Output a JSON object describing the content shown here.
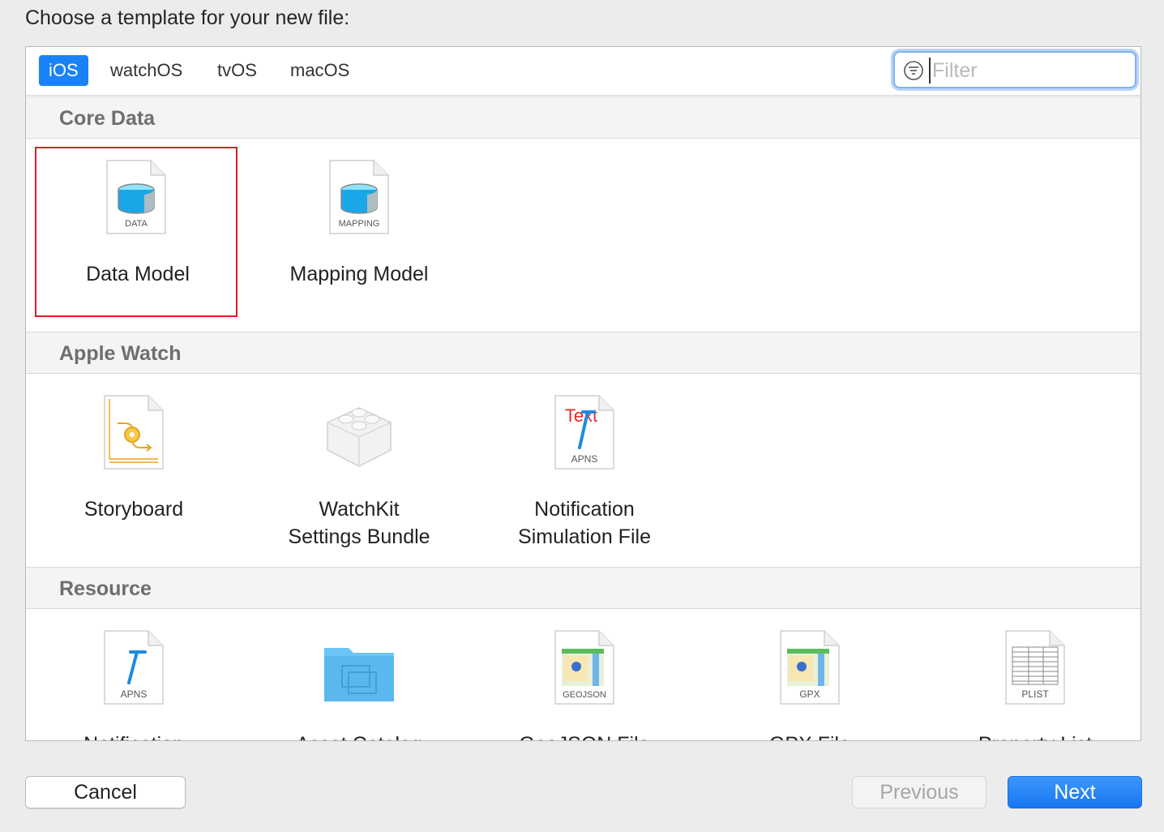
{
  "header": {
    "prompt": "Choose a template for your new file:"
  },
  "tabs": [
    {
      "label": "iOS",
      "active": true
    },
    {
      "label": "watchOS",
      "active": false
    },
    {
      "label": "tvOS",
      "active": false
    },
    {
      "label": "macOS",
      "active": false
    }
  ],
  "filter": {
    "placeholder": "Filter",
    "value": ""
  },
  "sections": [
    {
      "title": "Core Data",
      "items": [
        {
          "label": "Data Model",
          "icon": "data-model-icon",
          "icon_caption": "DATA",
          "selected": true
        },
        {
          "label": "Mapping Model",
          "icon": "mapping-model-icon",
          "icon_caption": "MAPPING",
          "selected": false
        }
      ]
    },
    {
      "title": "Apple Watch",
      "items": [
        {
          "label": "Storyboard",
          "icon": "storyboard-icon"
        },
        {
          "label": "WatchKit\nSettings Bundle",
          "line1": "WatchKit",
          "line2": "Settings Bundle",
          "icon": "settings-bundle-icon"
        },
        {
          "label": "Notification\nSimulation File",
          "line1": "Notification",
          "line2": "Simulation File",
          "icon": "apns-text-icon",
          "icon_caption": "APNS",
          "icon_text": "Text"
        }
      ]
    },
    {
      "title": "Resource",
      "items": [
        {
          "label": "Notification",
          "icon": "apns-icon",
          "icon_caption": "APNS"
        },
        {
          "label": "Asset Catalog",
          "icon": "asset-catalog-folder-icon"
        },
        {
          "label": "GeoJSON File",
          "icon": "geojson-map-icon",
          "icon_caption": "GEOJSON"
        },
        {
          "label": "GPX File",
          "icon": "gpx-map-icon",
          "icon_caption": "GPX"
        },
        {
          "label": "Property List",
          "icon": "plist-icon",
          "icon_caption": "PLIST"
        }
      ]
    }
  ],
  "buttons": {
    "cancel": "Cancel",
    "previous": "Previous",
    "next": "Next"
  },
  "colors": {
    "accent": "#1a82f7",
    "selection_outline": "#e01b24",
    "section_header_text": "#6e6e6e"
  }
}
